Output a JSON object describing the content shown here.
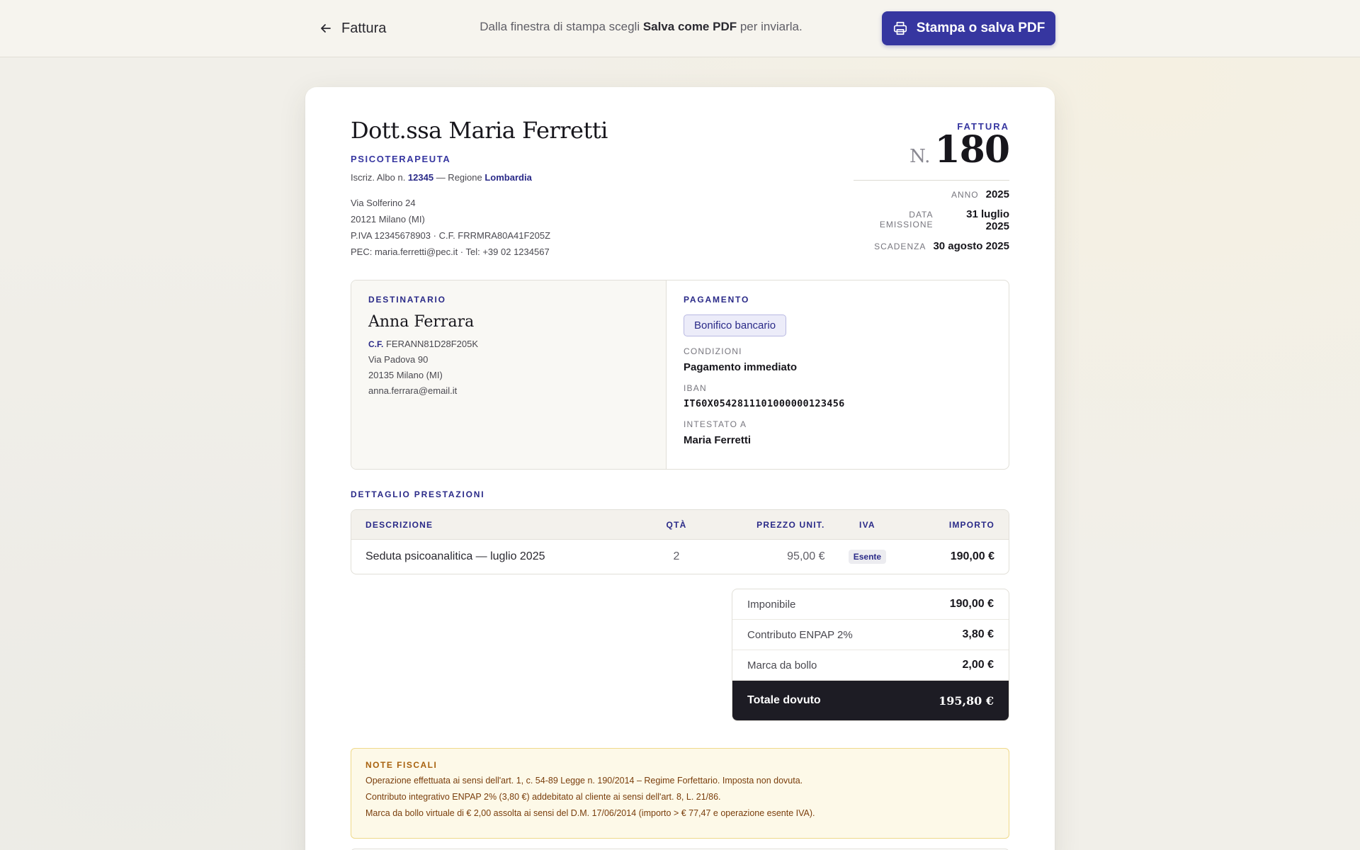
{
  "topbar": {
    "back_label": "Fattura",
    "hint_before": "Dalla finestra di stampa scegli ",
    "hint_bold": "Salva come PDF",
    "hint_after": " per inviarla.",
    "print_label": "Stampa o salva PDF"
  },
  "issuer": {
    "name": "Dott.ssa Maria Ferretti",
    "role": "PSICOTERAPEUTA",
    "albo_prefix": "Iscriz. Albo n. ",
    "albo_number": "12345",
    "albo_mid": " — Regione ",
    "albo_region": "Lombardia",
    "address_lines": [
      "Via Solferino 24",
      "20121 Milano (MI)",
      "P.IVA 12345678903 · C.F. FRRMRA80A41F205Z",
      "PEC: maria.ferretti@pec.it · Tel: +39 02 1234567"
    ]
  },
  "invoice": {
    "label": "FATTURA",
    "n_prefix": "N.",
    "number": "180",
    "meta": [
      {
        "key": "ANNO",
        "value": "2025"
      },
      {
        "key": "DATA EMISSIONE",
        "value": "31 luglio 2025"
      },
      {
        "key": "SCADENZA",
        "value": "30 agosto 2025"
      }
    ]
  },
  "recipient": {
    "title": "DESTINATARIO",
    "name": "Anna Ferrara",
    "cf_label": "C.F.",
    "cf_value": "FERANN81D28F205K",
    "lines": [
      "Via Padova 90",
      "20135 Milano (MI)",
      "anna.ferrara@email.it"
    ]
  },
  "payment": {
    "title": "PAGAMENTO",
    "method": "Bonifico bancario",
    "conditions_label": "CONDIZIONI",
    "conditions_value": "Pagamento immediato",
    "iban_label": "IBAN",
    "iban_value": "IT60X0542811101000000123456",
    "holder_label": "INTESTATO A",
    "holder_value": "Maria Ferretti"
  },
  "services": {
    "title": "DETTAGLIO PRESTAZIONI",
    "headers": {
      "desc": "DESCRIZIONE",
      "qty": "QTÀ",
      "price": "PREZZO UNIT.",
      "vat": "IVA",
      "amount": "IMPORTO"
    },
    "rows": [
      {
        "desc": "Seduta psicoanalitica — luglio 2025",
        "qty": "2",
        "price": "95,00 €",
        "vat": "Esente",
        "amount": "190,00 €"
      }
    ]
  },
  "totals": {
    "rows": [
      {
        "label": "Imponibile",
        "value": "190,00 €"
      },
      {
        "label": "Contributo ENPAP 2%",
        "value": "3,80 €"
      },
      {
        "label": "Marca da bollo",
        "value": "2,00 €"
      }
    ],
    "final_label": "Totale dovuto",
    "final_value": "195,80 €"
  },
  "notes": {
    "title": "NOTE FISCALI",
    "lines": [
      "Operazione effettuata ai sensi dell'art. 1, c. 54-89 Legge n. 190/2014 – Regime Forfettario. Imposta non dovuta.",
      "Contributo integrativo ENPAP 2% (3,80 €) addebitato al cliente ai sensi dell'art. 8, L. 21/86.",
      "Marca da bollo virtuale di € 2,00 assolta ai sensi del D.M. 17/06/2014 (importo > € 77,47 e operazione esente IVA)."
    ]
  },
  "colors": {
    "accent": "#3636a0",
    "dark_total": "#1d1c24",
    "note_bg": "#fdf9e8"
  },
  "icons": {
    "back": "arrow-left-icon",
    "print": "printer-icon"
  }
}
